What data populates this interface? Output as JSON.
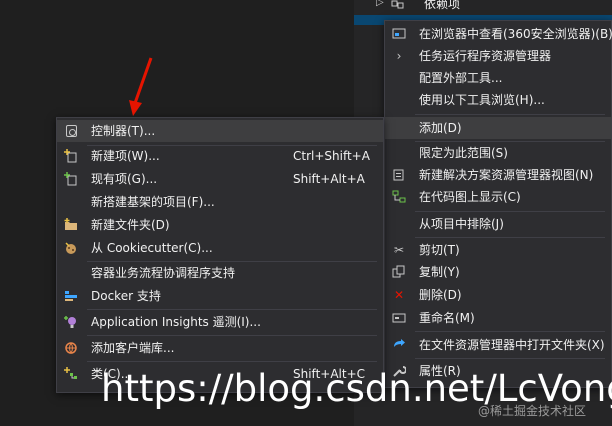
{
  "tree": {
    "node_label": "依赖项"
  },
  "context_menu_right": {
    "items": [
      {
        "label": "在浏览器中查看(360安全浏览器)(B)",
        "icon": "browser-icon"
      },
      {
        "label": "任务运行程序资源管理器",
        "icon": "chevron-right-icon"
      },
      {
        "label": "配置外部工具...",
        "icon": ""
      },
      {
        "label": "使用以下工具浏览(H)...",
        "icon": ""
      },
      {
        "label": "添加(D)",
        "icon": ""
      },
      {
        "label": "限定为此范围(S)",
        "icon": ""
      },
      {
        "label": "新建解决方案资源管理器视图(N)",
        "icon": "new-view-icon"
      },
      {
        "label": "在代码图上显示(C)",
        "icon": "code-map-icon"
      },
      {
        "label": "从项目中排除(J)",
        "icon": ""
      },
      {
        "label": "剪切(T)",
        "icon": "scissors-icon"
      },
      {
        "label": "复制(Y)",
        "icon": "copy-icon"
      },
      {
        "label": "删除(D)",
        "icon": "delete-x-icon"
      },
      {
        "label": "重命名(M)",
        "icon": "rename-icon"
      },
      {
        "label": "在文件资源管理器中打开文件夹(X)",
        "icon": "open-folder-arrow-icon"
      },
      {
        "label": "属性(R)",
        "icon": "wrench-icon"
      }
    ]
  },
  "context_menu_left": {
    "items": [
      {
        "label": "控制器(T)...",
        "shortcut": "",
        "icon": "controller-icon"
      },
      {
        "label": "新建项(W)...",
        "shortcut": "Ctrl+Shift+A",
        "icon": "new-item-icon"
      },
      {
        "label": "现有项(G)...",
        "shortcut": "Shift+Alt+A",
        "icon": "existing-item-icon"
      },
      {
        "label": "新搭建基架的项目(F)...",
        "shortcut": "",
        "icon": ""
      },
      {
        "label": "新建文件夹(D)",
        "shortcut": "",
        "icon": "new-folder-icon"
      },
      {
        "label": "从 Cookiecutter(C)...",
        "shortcut": "",
        "icon": "cookiecutter-icon"
      },
      {
        "label": "容器业务流程协调程序支持",
        "shortcut": "",
        "icon": ""
      },
      {
        "label": "Docker 支持",
        "shortcut": "",
        "icon": "docker-icon"
      },
      {
        "label": "Application Insights 遥测(I)...",
        "shortcut": "",
        "icon": "insights-bulb-icon"
      },
      {
        "label": "添加客户端库...",
        "shortcut": "",
        "icon": "client-library-icon"
      },
      {
        "label": "类(C)...",
        "shortcut": "Shift+Alt+C",
        "icon": "class-icon"
      }
    ]
  },
  "watermark": {
    "url_text": "https://blog.csdn.net/LcVong",
    "small_text": "@稀土掘金技术社区"
  },
  "colors": {
    "background": "#1f1f1f",
    "menu_bg": "#2d2d30",
    "menu_border": "#3f3f46",
    "highlight": "#3e3e40",
    "selection": "#094771",
    "pointer_arrow": "#e51400"
  }
}
